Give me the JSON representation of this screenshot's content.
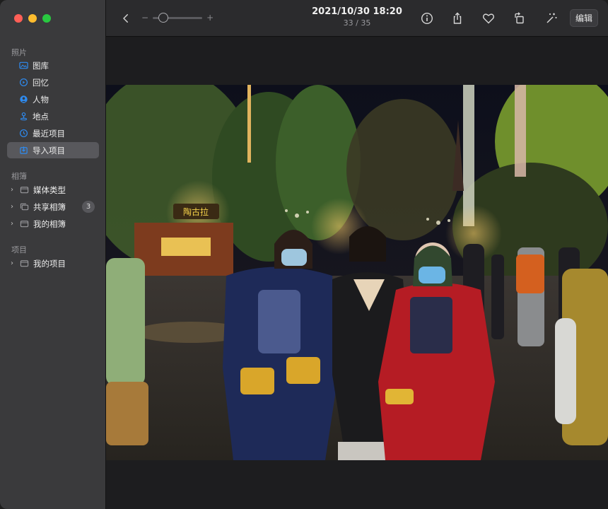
{
  "sidebar": {
    "photos_section": "照片",
    "items": [
      {
        "label": "图库",
        "icon": "photos-library-icon"
      },
      {
        "label": "回忆",
        "icon": "memories-icon"
      },
      {
        "label": "人物",
        "icon": "people-icon"
      },
      {
        "label": "地点",
        "icon": "places-icon"
      },
      {
        "label": "最近项目",
        "icon": "recents-clock-icon"
      },
      {
        "label": "导入项目",
        "icon": "import-icon",
        "selected": true
      }
    ],
    "albums_section": "相簿",
    "albums": [
      {
        "label": "媒体类型",
        "icon": "folder-icon"
      },
      {
        "label": "共享相簿",
        "icon": "shared-album-icon",
        "badge": "3"
      },
      {
        "label": "我的相簿",
        "icon": "folder-icon"
      }
    ],
    "projects_section": "项目",
    "projects": [
      {
        "label": "我的项目",
        "icon": "folder-icon"
      }
    ]
  },
  "toolbar": {
    "date_time": "2021/10/30 18:20",
    "photo_counter": "33 / 35",
    "zoom_minus": "−",
    "zoom_plus": "+",
    "zoom_level": 0.1,
    "edit_label": "编辑"
  },
  "photo": {
    "sign_text": "陶古拉"
  },
  "colors": {
    "sidebar_bg": "#3a3a3c",
    "selected_bg": "#58585c",
    "accent": "#2e8bf0",
    "toolbar_bg": "#2b2b2d"
  }
}
